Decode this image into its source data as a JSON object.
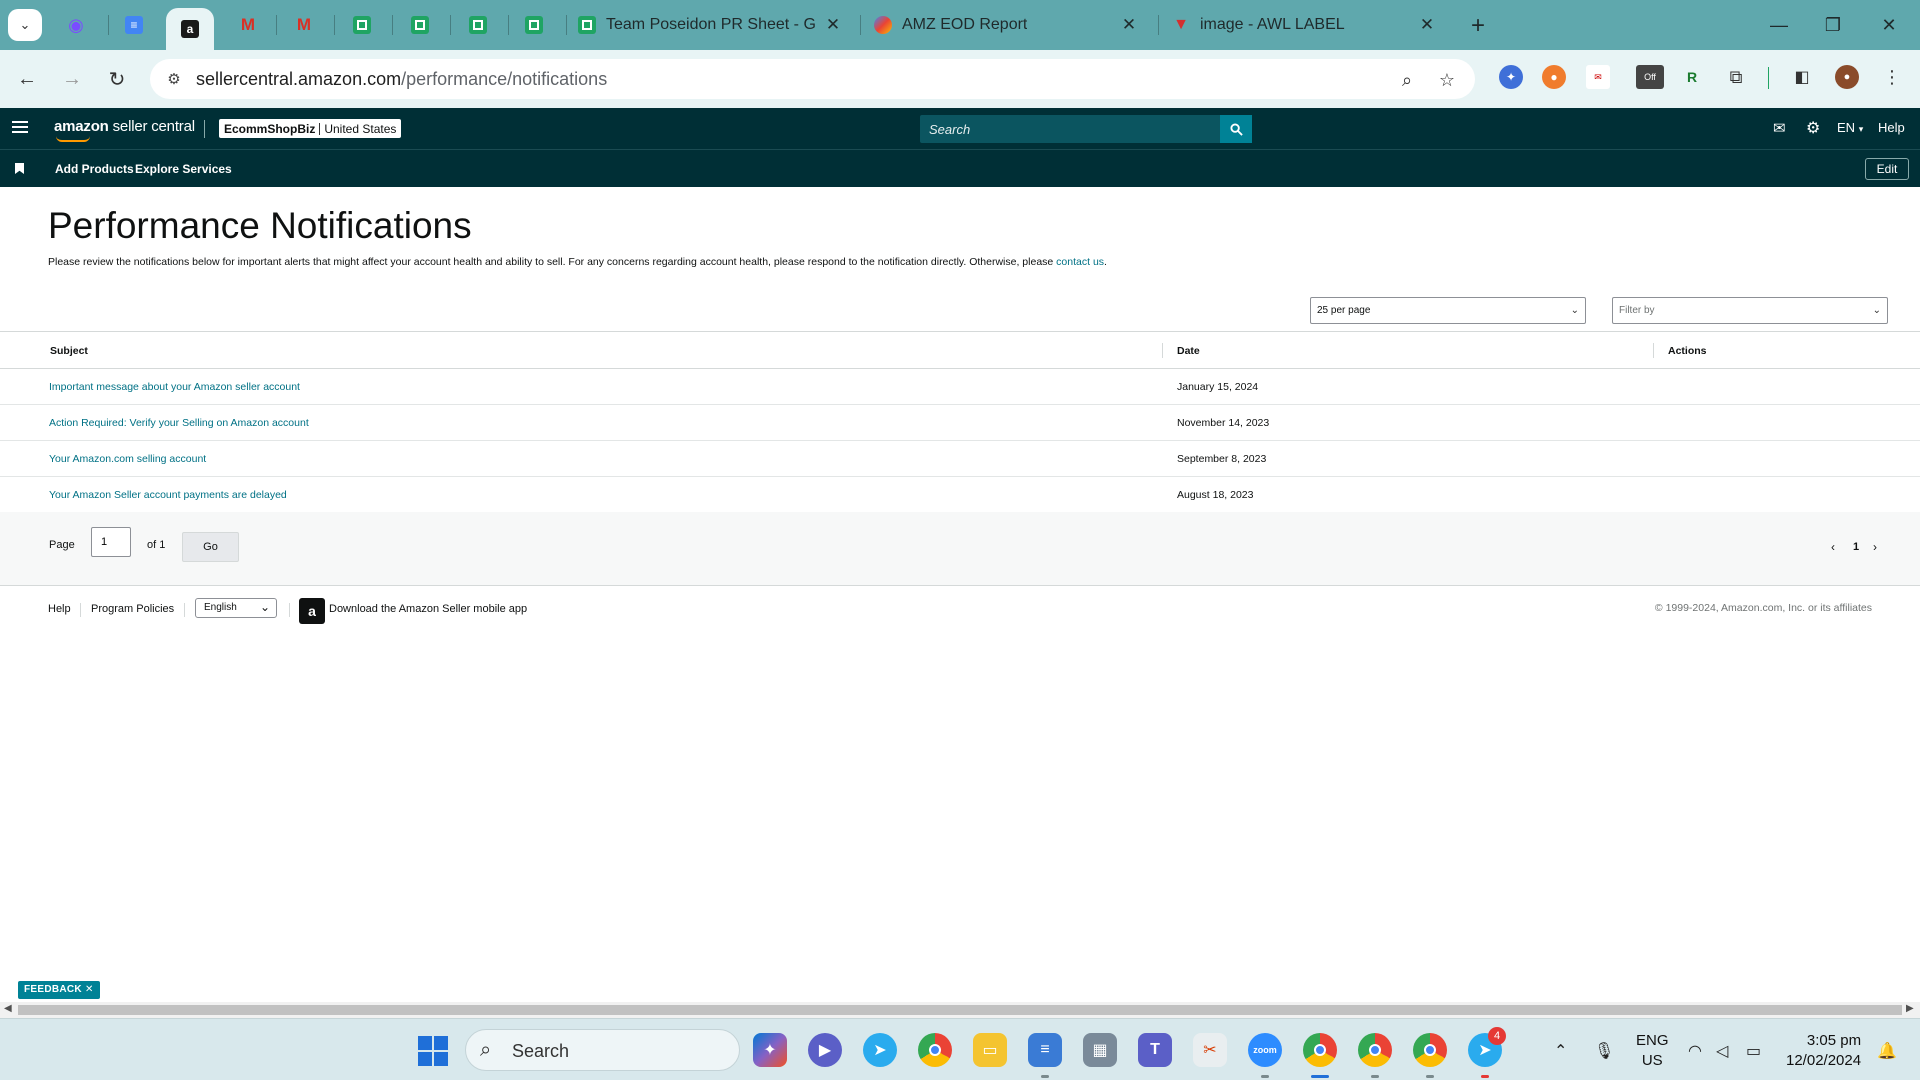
{
  "browser": {
    "pinned_tabs": [
      {
        "icon": "messenger-icon"
      },
      {
        "icon": "google-docs-icon"
      },
      {
        "icon": "amazon-icon",
        "active": true
      },
      {
        "icon": "gmail-icon"
      },
      {
        "icon": "gmail-icon"
      },
      {
        "icon": "google-sheets-icon"
      },
      {
        "icon": "google-sheets-icon"
      },
      {
        "icon": "google-sheets-icon"
      },
      {
        "icon": "google-sheets-icon"
      }
    ],
    "tabs": [
      {
        "title": "Team Poseidon PR Sheet - Goo",
        "icon": "google-sheets-icon"
      },
      {
        "title": "AMZ EOD Report",
        "icon": "looker-studio-icon"
      },
      {
        "title": "image - AWL LABEL",
        "icon": "awl-icon"
      }
    ],
    "url_host": "sellercentral.amazon.com",
    "url_path": "/performance/notifications",
    "extension_badge": "Off"
  },
  "seller_header": {
    "logo_brand": "amazon",
    "logo_sub": " seller central",
    "store_name": "EcommShopBiz",
    "marketplace": "United States",
    "search_placeholder": "Search",
    "language": "EN",
    "help_label": "Help",
    "nav_links": [
      "Add Products",
      "Explore Services"
    ],
    "edit_label": "Edit"
  },
  "page": {
    "title": "Performance Notifications",
    "intro": "Please review the notifications below for important alerts that might affect your account health and ability to sell. For any concerns regarding account health, please respond to the notification directly. Otherwise, please ",
    "intro_link": "contact us",
    "intro_end": ".",
    "per_page": "25 per page",
    "filter_placeholder": "Filter by",
    "columns": {
      "subject": "Subject",
      "date": "Date",
      "actions": "Actions"
    },
    "rows": [
      {
        "subject": "Important message about your Amazon seller account",
        "date": "January 15, 2024"
      },
      {
        "subject": "Action Required: Verify your Selling on Amazon account",
        "date": "November 14, 2023"
      },
      {
        "subject": "Your Amazon.com selling account",
        "date": "September 8, 2023"
      },
      {
        "subject": "Your Amazon Seller account payments are delayed",
        "date": "August 18, 2023"
      }
    ],
    "pager": {
      "page_label": "Page",
      "page_value": "1",
      "of_label": "of 1",
      "go_label": "Go",
      "current_page": "1"
    }
  },
  "footer": {
    "help": "Help",
    "program_policies": "Program Policies",
    "language": "English",
    "app_download": "Download the Amazon Seller mobile app",
    "copyright": "© 1999-2024, Amazon.com, Inc. or its affiliates"
  },
  "feedback_label": "FEEDBACK ✕",
  "taskbar": {
    "search_label": "Search",
    "lang_line1": "ENG",
    "lang_line2": "US",
    "time": "3:05 pm",
    "date": "12/02/2024",
    "telegram_badge": "4"
  },
  "colors": {
    "tabstrip": "#5fa8ad",
    "seller_header": "#002f36",
    "link": "#007185",
    "search_button": "#008296"
  }
}
